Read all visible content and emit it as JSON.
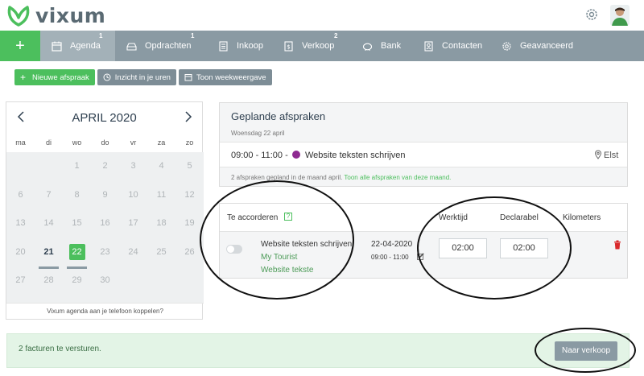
{
  "brand": {
    "name": "vixum",
    "color": "#4cbf5d"
  },
  "header": {
    "settings_icon": "gear-icon",
    "avatar": "user-avatar"
  },
  "nav": {
    "plus": "+",
    "items": [
      {
        "label": "Agenda",
        "icon": "calendar-icon",
        "badge": "1",
        "active": true
      },
      {
        "label": "Opdrachten",
        "icon": "inbox-icon",
        "badge": "1"
      },
      {
        "label": "Inkoop",
        "icon": "document-icon",
        "badge": ""
      },
      {
        "label": "Verkoop",
        "icon": "invoice-icon",
        "badge": "2"
      },
      {
        "label": "Bank",
        "icon": "piggy-bank-icon",
        "badge": ""
      },
      {
        "label": "Contacten",
        "icon": "contact-icon",
        "badge": ""
      },
      {
        "label": "Geavanceerd",
        "icon": "gear-icon",
        "badge": ""
      }
    ]
  },
  "toolbar": {
    "new": "Nieuwe afspraak",
    "hours": "Inzicht in je uren",
    "week": "Toon weekweergave"
  },
  "calendar": {
    "title": "APRIL 2020",
    "weekdays": [
      "ma",
      "di",
      "wo",
      "do",
      "vr",
      "za",
      "zo"
    ],
    "days": [
      [
        "",
        "",
        "1",
        "2",
        "3",
        "4",
        "5"
      ],
      [
        "6",
        "7",
        "8",
        "9",
        "10",
        "11",
        "12"
      ],
      [
        "13",
        "14",
        "15",
        "16",
        "17",
        "18",
        "19"
      ],
      [
        "20",
        "21",
        "22",
        "23",
        "24",
        "25",
        "26"
      ],
      [
        "27",
        "28",
        "29",
        "30",
        "",
        "",
        ""
      ]
    ],
    "today": "21",
    "selected": "22",
    "footer": "Vixum agenda aan je telefoon koppelen?"
  },
  "planned": {
    "title": "Geplande afspraken",
    "date": "Woensdag 22 april",
    "appointment": {
      "time": "09:00 - 11:00 -",
      "subject": "Website teksten schrijven",
      "location": "Elst",
      "color": "#8e2a91"
    },
    "note": "2 afspraken gepland in de maand april.",
    "note_link": "Toon alle afspraken van deze maand."
  },
  "accord": {
    "title": "Te accorderen",
    "help": "?",
    "col_worktime": "Werktijd",
    "col_billable": "Declarabel",
    "col_km": "Kilometers",
    "row": {
      "title": "Website teksten schrijven",
      "client": "My Tourist",
      "project": "Website tekste",
      "date": "22-04-2020",
      "time": "09:00 - 11:00",
      "worktime": "02:00",
      "billable": "02:00"
    }
  },
  "bottom": {
    "message": "2 facturen te versturen.",
    "button": "Naar verkoop"
  }
}
